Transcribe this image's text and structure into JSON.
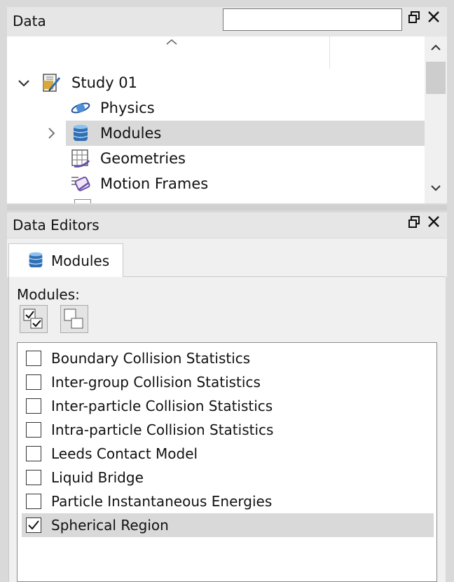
{
  "data_panel": {
    "title": "Data",
    "search": {
      "value": "",
      "placeholder": ""
    },
    "tree": {
      "study": "Study 01",
      "children": [
        "Physics",
        "Modules",
        "Geometries",
        "Motion Frames"
      ],
      "selected": "Modules"
    }
  },
  "editors_panel": {
    "title": "Data Editors",
    "tab_label": "Modules",
    "modules_label": "Modules:",
    "modules": [
      {
        "label": "Boundary Collision Statistics",
        "checked": false
      },
      {
        "label": "Inter-group Collision Statistics",
        "checked": false
      },
      {
        "label": "Inter-particle Collision Statistics",
        "checked": false
      },
      {
        "label": "Intra-particle Collision Statistics",
        "checked": false
      },
      {
        "label": "Leeds Contact Model",
        "checked": false
      },
      {
        "label": "Liquid Bridge",
        "checked": false
      },
      {
        "label": "Particle Instantaneous Energies",
        "checked": false
      },
      {
        "label": "Spherical Region",
        "checked": true
      }
    ]
  },
  "icons": {
    "float": "restore-window-icon",
    "close": "close-icon",
    "study": "study-document-icon",
    "physics": "physics-icon",
    "modules": "modules-database-icon",
    "geometries": "geometries-grid-icon",
    "motion": "motion-frames-icon"
  },
  "colors": {
    "selection": "#d9d9d9",
    "accent_blue": "#2f6fb3"
  }
}
